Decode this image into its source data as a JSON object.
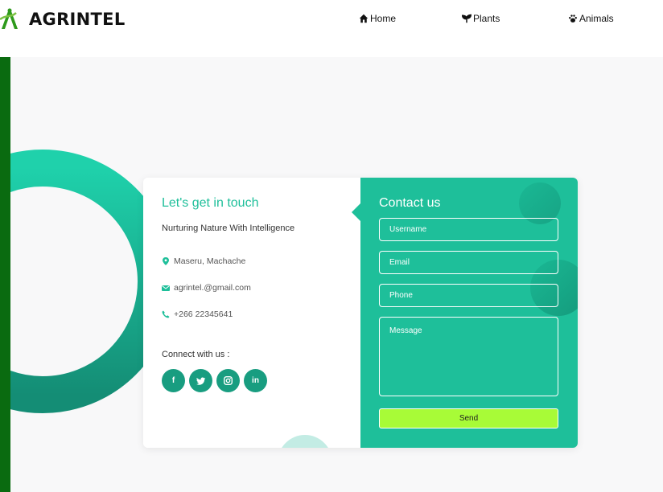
{
  "brand": {
    "name": "AGRINTEL"
  },
  "nav": {
    "home": {
      "label": "Home",
      "icon": "home-icon"
    },
    "plants": {
      "label": "Plants",
      "icon": "seedling-icon"
    },
    "animals": {
      "label": "Animals",
      "icon": "paw-icon"
    }
  },
  "contact_info": {
    "title": "Let's get in touch",
    "subtitle": "Nurturing Nature With Intelligence",
    "address": "Maseru, Machache",
    "email": "agrintel.@gmail.com",
    "phone": "+266 22345641",
    "connect_label": "Connect with us :",
    "socials": [
      {
        "label": "f",
        "icon": "facebook-icon"
      },
      {
        "label": "twitter",
        "icon": "twitter-icon"
      },
      {
        "label": "instagram",
        "icon": "instagram-icon"
      },
      {
        "label": "in",
        "icon": "linkedin-icon"
      }
    ]
  },
  "form": {
    "title": "Contact us",
    "username_placeholder": "Username",
    "email_placeholder": "Email",
    "phone_placeholder": "Phone",
    "message_placeholder": "Message",
    "send_label": "Send"
  },
  "colors": {
    "accent": "#1ebf9a",
    "accent_dark": "#189d80",
    "side_bar": "#0a6b10",
    "send_button": "#a8fb37"
  }
}
